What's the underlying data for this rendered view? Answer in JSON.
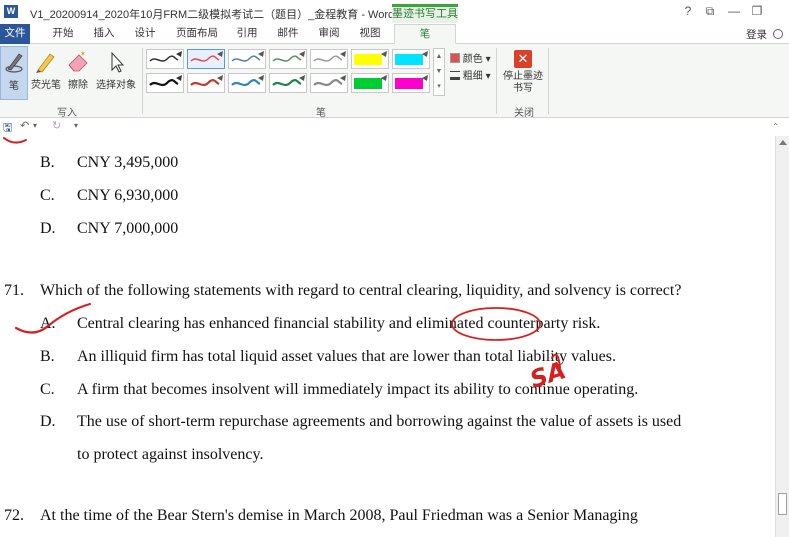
{
  "window": {
    "title": "V1_20200914_2020年10月FRM二级模拟考试二（题目）_金程教育 - Word",
    "app_icon": "W",
    "context_tab_title": "墨迹书写工具",
    "controls": {
      "help": "?",
      "ribbon_display": "⧉",
      "minimize": "—",
      "restore": "❐"
    },
    "login": "登录"
  },
  "menu": {
    "file": "文件",
    "tabs": [
      "开始",
      "插入",
      "设计",
      "页面布局",
      "引用",
      "邮件",
      "审阅",
      "视图"
    ],
    "active_tab": "笔"
  },
  "ribbon": {
    "write_group": {
      "label": "写入",
      "pen": "笔",
      "highlighter": "荧光笔",
      "eraser": "擦除",
      "select_objects": "选择对象"
    },
    "pens_group": {
      "label": "笔",
      "color_option": "颜色",
      "weight_option": "粗细",
      "pen_colors": [
        "#333333",
        "#e05050",
        "#555555",
        "#555555",
        "#888888",
        "#ffff00",
        "#00e5ff",
        "#111111",
        "#c0392b",
        "#2e86c1",
        "#1e8449",
        "#888888",
        "#00cc33",
        "#ff00cc"
      ]
    },
    "close_group": {
      "label": "关闭",
      "stop_inking": "停止墨迹书写"
    }
  },
  "document": {
    "prev_options": [
      {
        "letter": "B.",
        "text": "CNY 3,495,000"
      },
      {
        "letter": "C.",
        "text": "CNY 6,930,000"
      },
      {
        "letter": "D.",
        "text": "CNY 7,000,000"
      }
    ],
    "q71": {
      "number": "71.",
      "question": "Which of the following statements with regard to central clearing, liquidity, and solvency is correct?",
      "options": [
        {
          "letter": "A.",
          "text": "Central clearing has enhanced financial stability and eliminated counterparty risk."
        },
        {
          "letter": "B.",
          "text": "An illiquid firm has total liquid asset values that are lower than total liability values."
        },
        {
          "letter": "C.",
          "text": "A firm that becomes insolvent will immediately impact its ability to continue operating."
        },
        {
          "letter": "D.",
          "text": "The use of short-term repurchase agreements and borrowing against the value of assets is used"
        }
      ],
      "option_d_continued": "to protect against insolvency."
    },
    "q72": {
      "number": "72.",
      "question": "At the time of the Bear Stern's demise in March 2008, Paul Friedman was a Senior Managing"
    },
    "ink_note": "SA"
  }
}
